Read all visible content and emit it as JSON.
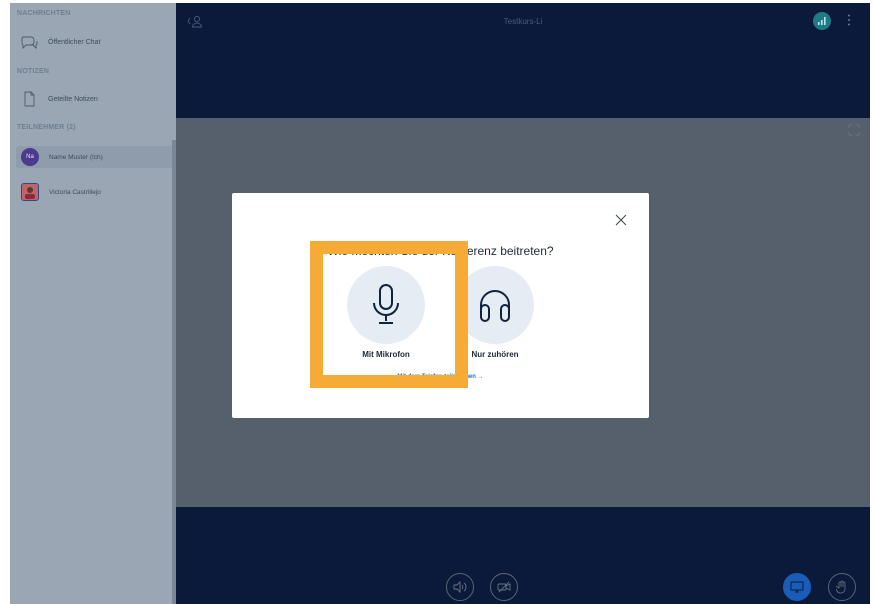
{
  "sidebar": {
    "messages_header": "NACHRICHTEN",
    "public_chat_label": "Öffentlicher Chat",
    "notes_header": "NOTIZEN",
    "shared_notes_label": "Geteilte Notizen",
    "participants_header": "TEILNEHMER (2)",
    "users": [
      {
        "initials": "Na",
        "name": "Name Muster (Ich)",
        "avatar_color": "#4b3a8f"
      },
      {
        "initials": "",
        "name": "Victoria Castrillejo",
        "avatar_color": "#c0646a"
      }
    ]
  },
  "header": {
    "title": "Testkurs-Li"
  },
  "modal": {
    "question": "Wie möchten Sie der Konferenz beitreten?",
    "microphone_label": "Mit Mikrofon",
    "listen_label": "Nur zuhören",
    "phone_link": "Mit dem Telefon teilnehmen →"
  },
  "colors": {
    "accent_blue": "#1a78c8",
    "highlight_orange": "#f5ab35",
    "bar_navy": "#0b1a3a"
  },
  "icons": {
    "user_list": "user-icon",
    "connection": "signal-icon",
    "options": "kebab-menu-icon",
    "fullscreen": "fullscreen-icon",
    "audio": "speaker-icon",
    "video": "camera-off-icon",
    "screenshare": "screen-share-icon",
    "raise_hand": "hand-icon",
    "close": "close-icon",
    "microphone": "microphone-icon",
    "headphones": "headphones-icon"
  }
}
